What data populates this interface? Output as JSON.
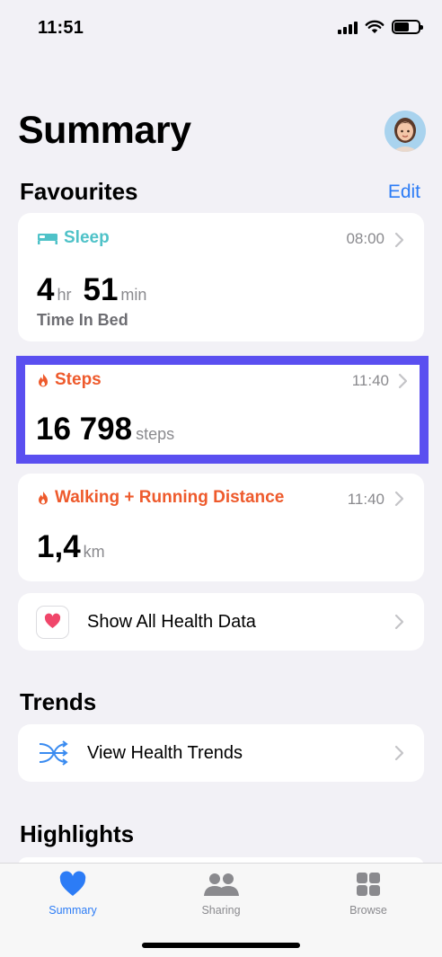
{
  "status": {
    "time": "11:51"
  },
  "page": {
    "title": "Summary"
  },
  "favourites": {
    "title": "Favourites",
    "edit_label": "Edit",
    "sleep": {
      "title": "Sleep",
      "time": "08:00",
      "hours": "4",
      "hours_unit": "hr",
      "minutes": "51",
      "minutes_unit": "min",
      "subtitle": "Time In Bed",
      "color": "#4fc2c8"
    },
    "steps": {
      "title": "Steps",
      "time": "11:40",
      "value": "16 798",
      "unit": "steps",
      "color": "#ee5a2c"
    },
    "distance": {
      "title": "Walking + Running Distance",
      "time": "11:40",
      "value": "1,4",
      "unit": "km",
      "color": "#ee5a2c"
    },
    "show_all_label": "Show All Health Data"
  },
  "trends": {
    "title": "Trends",
    "view_label": "View Health Trends"
  },
  "highlights": {
    "title": "Highlights"
  },
  "tabbar": {
    "active_color": "#2c7cf6",
    "inactive_color": "#8a8a8e",
    "tabs": [
      {
        "label": "Summary",
        "icon": "heart-icon"
      },
      {
        "label": "Sharing",
        "icon": "people-icon"
      },
      {
        "label": "Browse",
        "icon": "grid-icon"
      }
    ]
  }
}
